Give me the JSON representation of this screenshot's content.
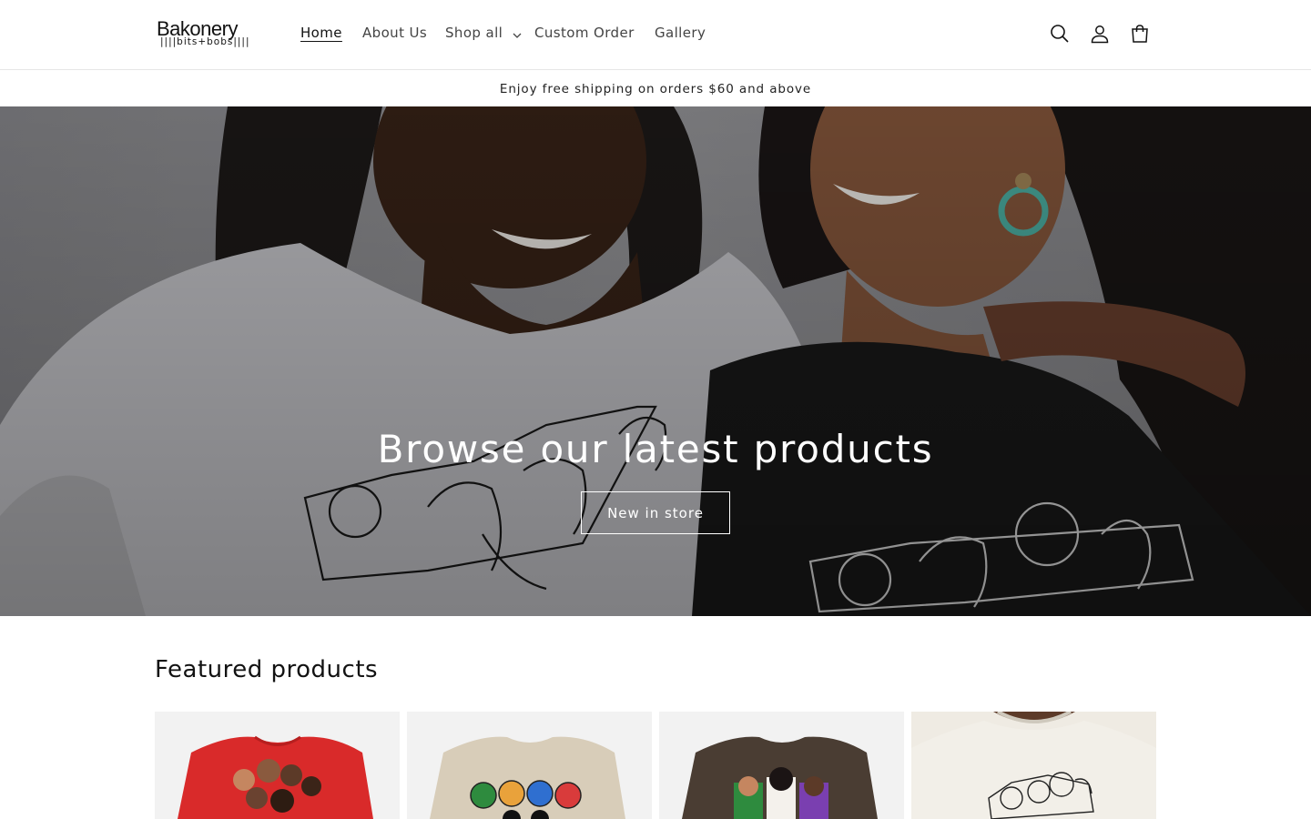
{
  "header": {
    "logo": {
      "main": "Bakonery",
      "sub": "||||bits+bobs||||"
    },
    "nav": [
      {
        "label": "Home",
        "active": true
      },
      {
        "label": "About Us",
        "active": false
      },
      {
        "label": "Shop all",
        "active": false,
        "has_dropdown": true
      },
      {
        "label": "Custom Order",
        "active": false
      },
      {
        "label": "Gallery",
        "active": false
      }
    ],
    "icons": [
      "search-icon",
      "account-icon",
      "cart-icon"
    ]
  },
  "announcement": {
    "text": "Enjoy free shipping on orders $60 and above"
  },
  "hero": {
    "title": "Browse our latest products",
    "button_label": "New in store"
  },
  "featured": {
    "title": "Featured products",
    "products": [
      {
        "image": "red-sweatshirt",
        "color": "#d92a2a"
      },
      {
        "image": "sand-sweatshirt",
        "color": "#d8cdb9"
      },
      {
        "image": "brown-sweatshirt",
        "color": "#4a3d33"
      },
      {
        "image": "cream-sweatshirt-model",
        "color": "#efebe3"
      }
    ]
  }
}
